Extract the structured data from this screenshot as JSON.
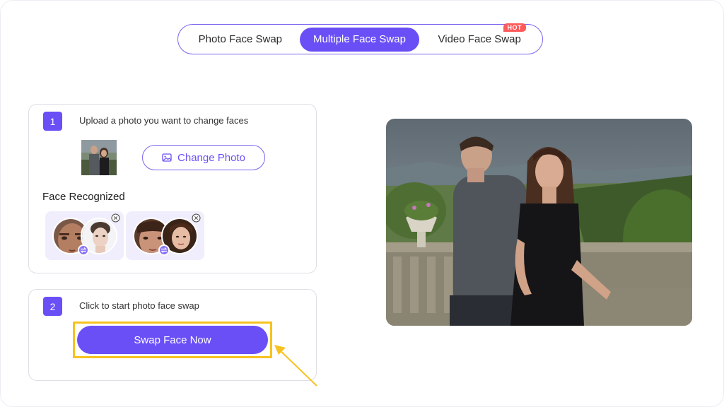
{
  "tabs": [
    {
      "label": "Photo Face Swap",
      "active": false
    },
    {
      "label": "Multiple Face Swap",
      "active": true
    },
    {
      "label": "Video Face Swap",
      "active": false,
      "badge": "HOT"
    }
  ],
  "step1": {
    "number": "1",
    "text": "Upload a photo you want to change faces",
    "change_button": "Change Photo",
    "change_icon": "image-icon",
    "faces_label": "Face Recognized",
    "face_pairs": [
      {
        "source": "man-face",
        "target": "man-face-replacement",
        "swap_icon": "swap-icon",
        "close_icon": "close-circle-icon"
      },
      {
        "source": "woman-face",
        "target": "woman-face-replacement",
        "swap_icon": "swap-icon",
        "close_icon": "close-circle-icon"
      }
    ]
  },
  "step2": {
    "number": "2",
    "text": "Click to start photo face swap",
    "button": "Swap Face Now"
  },
  "colors": {
    "accent": "#6a4ff7",
    "highlight": "#f7c21f",
    "hot_badge": "#ff5a5a"
  }
}
